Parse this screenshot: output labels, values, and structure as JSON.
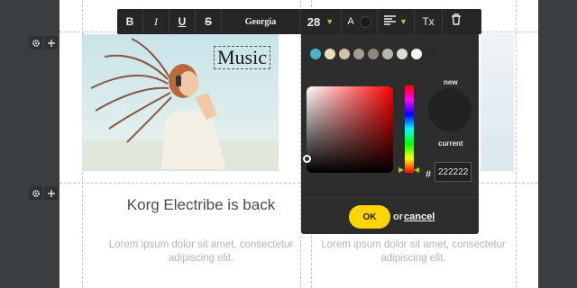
{
  "toolbar": {
    "bold": "B",
    "italic": "I",
    "underline": "U",
    "strikethrough": "S",
    "font": "Georgia",
    "size": "28",
    "color_letter": "A",
    "clear_format": "Tx"
  },
  "canvas": {
    "image_text": "Music",
    "headline": "Korg Electribe is back",
    "body_left": "Lorem ipsum dolor sit amet, consectetur adipiscing elit.",
    "body_right": "Lorem ipsum dolor sit amet, consectetur adipiscing elit."
  },
  "picker": {
    "presets": [
      "#4fb3c8",
      "#e8dcbc",
      "#cfc3a4",
      "#a39e8e",
      "#8d8878",
      "#b9b6ad",
      "#dcdbd6",
      "#f5f5f3",
      "#2a2a2a"
    ],
    "new_label": "new",
    "current_label": "current",
    "hash": "#",
    "hex_value": "222222",
    "ok_label": "OK",
    "or_label": "or",
    "cancel_label": "cancel"
  },
  "colors": {
    "toolbar_bg": "#262626",
    "accent": "#b4c71e",
    "ok_button": "#ffd500",
    "current_color": "#222222"
  }
}
